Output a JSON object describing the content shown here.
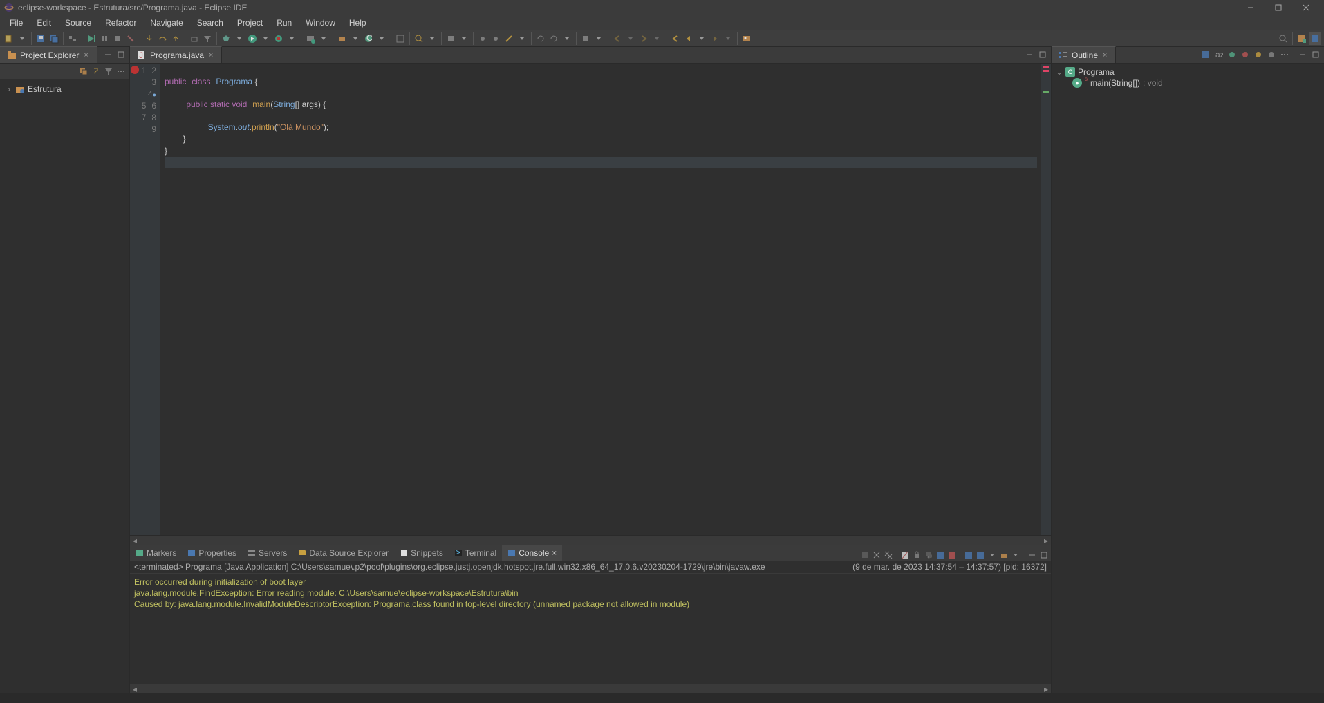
{
  "window": {
    "title": "eclipse-workspace - Estrutura/src/Programa.java - Eclipse IDE"
  },
  "menu": [
    "File",
    "Edit",
    "Source",
    "Refactor",
    "Navigate",
    "Search",
    "Project",
    "Run",
    "Window",
    "Help"
  ],
  "project_explorer": {
    "title": "Project Explorer",
    "root": "Estrutura"
  },
  "editor": {
    "tab": "Programa.java",
    "lines": [
      "1",
      "2",
      "3",
      "4",
      "5",
      "6",
      "7",
      "8",
      "9"
    ],
    "code": {
      "l2_kw1": "public",
      "l2_kw2": "class",
      "l2_cls": "Programa",
      "l2_brace": " {",
      "l4_kw": "public static void",
      "l4_m": "main",
      "l4_p1": "(",
      "l4_t": "String",
      "l4_p2": "[] args) {",
      "l6_sys": "System",
      "l6_dot1": ".",
      "l6_out": "out",
      "l6_dot2": ".",
      "l6_pr": "println",
      "l6_p1": "(",
      "l6_str": "\"Olá Mundo\"",
      "l6_p2": ");",
      "l7": "        }",
      "l8": "}"
    }
  },
  "outline": {
    "title": "Outline",
    "class": "Programa",
    "method": "main(String[]) ",
    "ret": ": void"
  },
  "bottom_tabs": [
    "Markers",
    "Properties",
    "Servers",
    "Data Source Explorer",
    "Snippets",
    "Terminal",
    "Console"
  ],
  "console": {
    "desc_left": "<terminated> Programa [Java Application] C:\\Users\\samue\\.p2\\pool\\plugins\\org.eclipse.justj.openjdk.hotspot.jre.full.win32.x86_64_17.0.6.v20230204-1729\\jre\\bin\\javaw.exe",
    "desc_right": "(9 de mar. de 2023 14:37:54 – 14:37:57) [pid: 16372]",
    "l1": "Error occurred during initialization of boot layer",
    "l2a": "java.lang.module.FindException",
    "l2b": ": Error reading module: C:\\Users\\samue\\eclipse-workspace\\Estrutura\\bin",
    "l3a": "Caused by: ",
    "l3b": "java.lang.module.InvalidModuleDescriptorException",
    "l3c": ": Programa.class found in top-level directory (unnamed package not allowed in module)"
  }
}
